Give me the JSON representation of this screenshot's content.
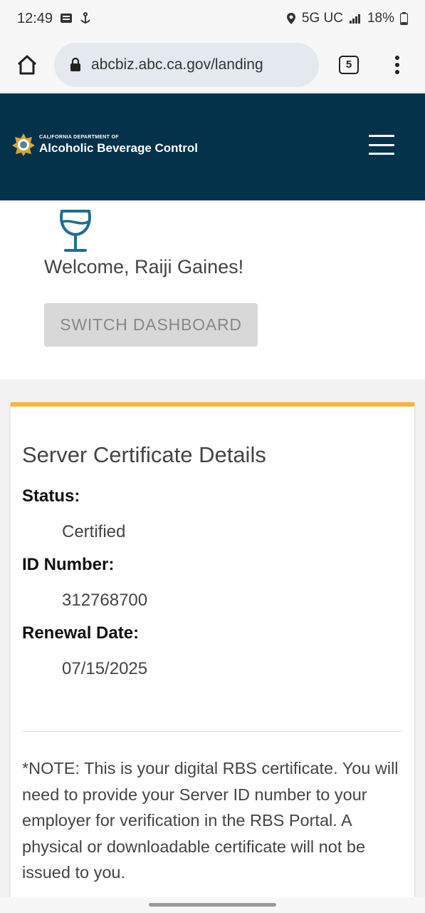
{
  "status_bar": {
    "time": "12:49",
    "network": "5G UC",
    "battery": "18%"
  },
  "browser": {
    "url": "abcbiz.abc.ca.gov/landing",
    "tab_count": "5"
  },
  "header": {
    "dept_small": "CALIFORNIA DEPARTMENT OF",
    "dept_name": "Alcoholic Beverage Control"
  },
  "welcome": {
    "greeting": "Welcome, Raiji Gaines!",
    "switch_label": "SWITCH DASHBOARD"
  },
  "certificate": {
    "title": "Server Certificate Details",
    "status_label": "Status:",
    "status_value": "Certified",
    "id_label": "ID Number:",
    "id_value": "312768700",
    "renewal_label": "Renewal Date:",
    "renewal_value": "07/15/2025",
    "note": "*NOTE: This is your digital RBS certificate. You will need to provide your Server ID number to your employer for verification in the RBS Portal. A physical or downloadable certificate will not be issued to you."
  },
  "colors": {
    "header_bg": "#03324a",
    "card_accent": "#f7b536",
    "icon_teal": "#1e6e8e"
  }
}
